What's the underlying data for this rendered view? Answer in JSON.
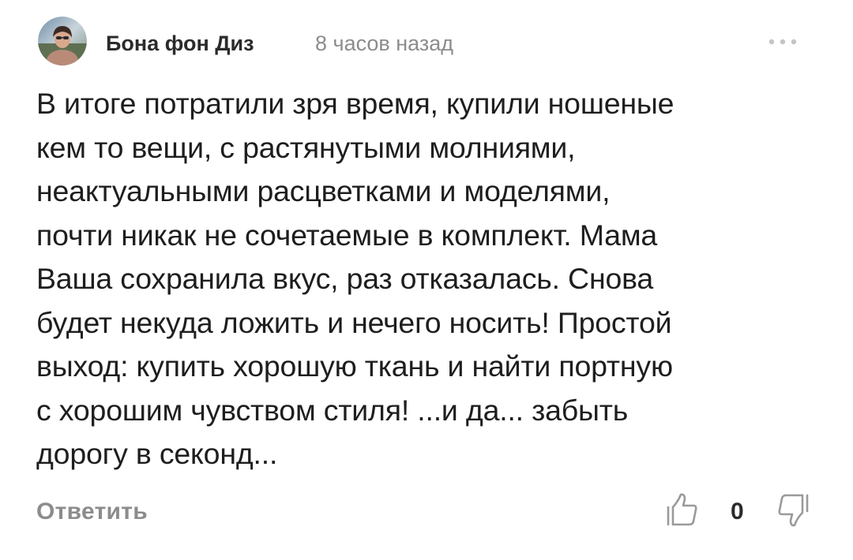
{
  "comment": {
    "author": "Бона фон Диз",
    "time": "8 часов назад",
    "text_lines": [
      "В итоге потратили зря время, купили ношеные",
      "кем то вещи, с растянутыми молниями,",
      "неактуальными расцветками и моделями,",
      "почти никак не сочетаемые в комплект. Мама",
      "Ваша сохранила вкус, раз отказалась. Снова",
      "будет некуда ложить и нечего носить! Простой",
      "выход: купить хорошую ткань и найти портную",
      "с хорошим чувством стиля! ...и да... забыть",
      "дорогу в секонд..."
    ],
    "reply_label": "Ответить",
    "like_count": "0"
  },
  "icons": {
    "more": "more-dots-icon",
    "like": "thumbs-up-icon",
    "dislike": "thumbs-down-icon"
  },
  "colors": {
    "text": "#1e1e1e",
    "muted": "#8c8c8c",
    "icon": "#a0a0a0"
  }
}
